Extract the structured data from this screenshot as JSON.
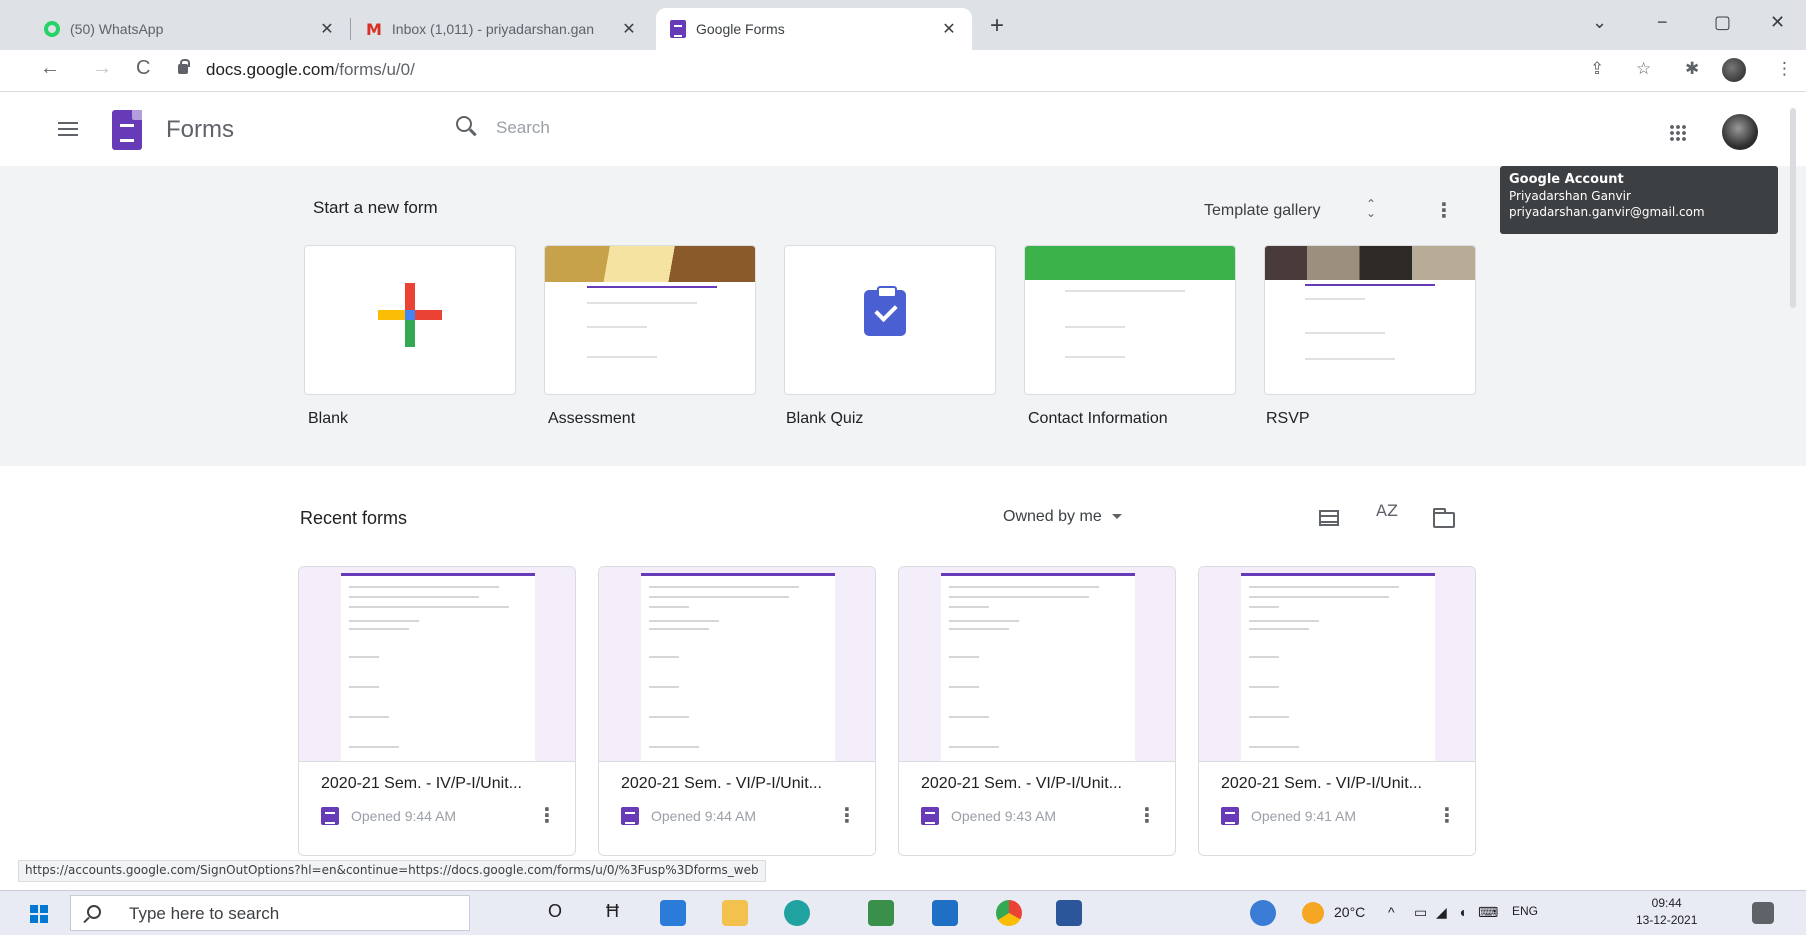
{
  "browser": {
    "tabs": [
      {
        "title": "(50) WhatsApp",
        "icon": "whatsapp-icon",
        "active": false
      },
      {
        "title": "Inbox (1,011) - priyadarshan.gan",
        "icon": "gmail-icon",
        "active": false
      },
      {
        "title": "Google Forms",
        "icon": "forms-icon",
        "active": true
      }
    ],
    "new_tab": "+",
    "window_controls": {
      "minimize": "−",
      "maximize": "▢",
      "close": "✕",
      "tab_search": "⌄"
    },
    "nav": {
      "back": "←",
      "forward": "→",
      "reload": "C"
    },
    "url_host": "docs.google.com",
    "url_path": "/forms/u/0/",
    "toolbar_icons": {
      "share": "⇪",
      "bookmark": "☆",
      "extensions": "✱",
      "menu": "⋮"
    }
  },
  "header": {
    "app_name": "Forms",
    "search_placeholder": "Search"
  },
  "account_tooltip": {
    "title": "Google Account",
    "name": "Priyadarshan Ganvir",
    "email": "priyadarshan.ganvir@gmail.com"
  },
  "start": {
    "title": "Start a new form",
    "template_gallery": "Template gallery",
    "gallery_chevrons": "⌃⌄",
    "more": "⋮",
    "templates": [
      {
        "label": "Blank"
      },
      {
        "label": "Assessment"
      },
      {
        "label": "Blank Quiz"
      },
      {
        "label": "Contact Information"
      },
      {
        "label": "RSVP"
      }
    ]
  },
  "recent": {
    "title": "Recent forms",
    "owner_filter": "Owned by me",
    "sort_label": "AZ",
    "forms": [
      {
        "title": "2020-21 Sem. - IV/P-I/Unit...",
        "opened": "Opened 9:44 AM",
        "more": "⋮"
      },
      {
        "title": "2020-21 Sem. - VI/P-I/Unit...",
        "opened": "Opened 9:44 AM",
        "more": "⋮"
      },
      {
        "title": "2020-21 Sem. - VI/P-I/Unit...",
        "opened": "Opened 9:43 AM",
        "more": "⋮"
      },
      {
        "title": "2020-21 Sem. - VI/P-I/Unit...",
        "opened": "Opened 9:41 AM",
        "more": "⋮"
      }
    ]
  },
  "status_bar_url": "https://accounts.google.com/SignOutOptions?hl=en&continue=https://docs.google.com/forms/u/0/%3Fusp%3Dforms_web",
  "taskbar": {
    "search_placeholder": "Type here to search",
    "task_view": "Ħ",
    "cortana": "O",
    "weather": "20°C",
    "tray_caret": "^",
    "language": "ENG",
    "time": "09:44",
    "date": "13-12-2021"
  },
  "colors": {
    "forms_purple": "#673ab7",
    "start_band": "#f1f3f4",
    "tooltip_bg": "#3c4043"
  }
}
